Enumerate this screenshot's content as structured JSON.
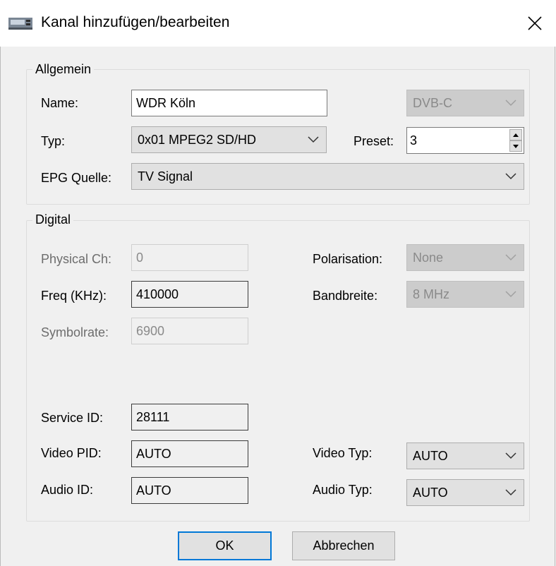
{
  "window": {
    "title": "Kanal hinzufügen/bearbeiten"
  },
  "allgemein": {
    "legend": "Allgemein",
    "name_label": "Name:",
    "name_value": "WDR Köln",
    "source_value": "DVB-C",
    "typ_label": "Typ:",
    "typ_value": "0x01 MPEG2 SD/HD",
    "preset_label": "Preset:",
    "preset_value": "3",
    "epg_label": "EPG Quelle:",
    "epg_value": "TV Signal"
  },
  "digital": {
    "legend": "Digital",
    "physical_ch_label": "Physical Ch:",
    "physical_ch_value": "0",
    "polarisation_label": "Polarisation:",
    "polarisation_value": "None",
    "freq_label": "Freq (KHz):",
    "freq_value": "410000",
    "bandbreite_label": "Bandbreite:",
    "bandbreite_value": "8 MHz",
    "symbolrate_label": "Symbolrate:",
    "symbolrate_value": "6900",
    "service_id_label": "Service ID:",
    "service_id_value": "28111",
    "video_pid_label": "Video PID:",
    "video_pid_value": "AUTO",
    "video_typ_label": "Video Typ:",
    "video_typ_value": "AUTO",
    "audio_id_label": "Audio ID:",
    "audio_id_value": "AUTO",
    "audio_typ_label": "Audio Typ:",
    "audio_typ_value": "AUTO"
  },
  "buttons": {
    "ok": "OK",
    "cancel": "Abbrechen"
  },
  "icons": {
    "app": "tv-tuner-icon",
    "close": "close-icon",
    "dropdown": "chevron-down-icon",
    "spin_up": "triangle-up-icon",
    "spin_down": "triangle-down-icon"
  }
}
